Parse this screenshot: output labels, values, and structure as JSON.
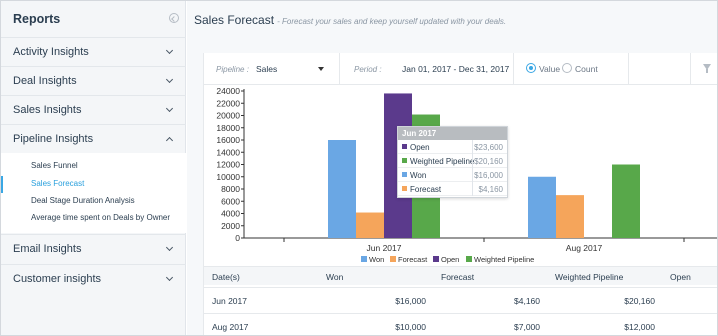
{
  "sidebar": {
    "title": "Reports",
    "sections": [
      {
        "label": "Activity Insights",
        "expanded": false
      },
      {
        "label": "Deal Insights",
        "expanded": false
      },
      {
        "label": "Sales Insights",
        "expanded": false
      },
      {
        "label": "Pipeline Insights",
        "expanded": true
      },
      {
        "label": "Email Insights",
        "expanded": false
      },
      {
        "label": "Customer insights",
        "expanded": false
      }
    ],
    "pipeline_items": [
      {
        "label": "Sales Funnel",
        "active": false
      },
      {
        "label": "Sales Forecast",
        "active": true
      },
      {
        "label": "Deal Stage Duration Analysis",
        "active": false
      },
      {
        "label": "Average time spent on Deals by Owner",
        "active": false
      }
    ]
  },
  "header": {
    "title": "Sales Forecast",
    "subtitle": "- Forecast your sales and keep yourself updated with your deals."
  },
  "filters": {
    "pipeline_label": "Pipeline :",
    "pipeline_value": "Sales",
    "period_label": "Period :",
    "period_value": "Jan 01, 2017 - Dec 31, 2017",
    "radio_value": "Value",
    "radio_count": "Count",
    "selected_mode": "Value",
    "filter_icon": "filter-icon"
  },
  "colors": {
    "won": "#6aa7e4",
    "forecast": "#f5a55b",
    "open": "#5b3a8c",
    "weighted": "#58a84a",
    "accent": "#3aa7e4"
  },
  "chart_data": {
    "type": "bar",
    "categories": [
      "Jun 2017",
      "Aug 2017"
    ],
    "series": [
      {
        "name": "Won",
        "values": [
          16000,
          10000
        ]
      },
      {
        "name": "Forecast",
        "values": [
          4160,
          7000
        ]
      },
      {
        "name": "Open",
        "values": [
          23600,
          null
        ]
      },
      {
        "name": "Weighted Pipeline",
        "values": [
          20160,
          12000
        ]
      }
    ],
    "y_ticks": [
      "0",
      "2000",
      "4000",
      "6000",
      "8000",
      "10000",
      "12000",
      "14000",
      "16000",
      "18000",
      "20000",
      "22000",
      "24000"
    ],
    "ylim": [
      0,
      24000
    ],
    "legend_position": "bottom",
    "tooltip": {
      "title": "Jun 2017",
      "rows": [
        {
          "name": "Open",
          "value": "$23,600",
          "color": "#5b3a8c"
        },
        {
          "name": "Weighted Pipeline",
          "value": "$20,160",
          "color": "#58a84a"
        },
        {
          "name": "Won",
          "value": "$16,000",
          "color": "#6aa7e4"
        },
        {
          "name": "Forecast",
          "value": "$4,160",
          "color": "#f5a55b"
        }
      ]
    }
  },
  "table": {
    "headers": [
      "Date(s)",
      "Won",
      "Forecast",
      "Weighted Pipeline",
      "Open"
    ],
    "rows": [
      {
        "date": "Jun 2017",
        "won": "$16,000",
        "forecast": "$4,160",
        "weighted": "$20,160",
        "open": ""
      },
      {
        "date": "Aug 2017",
        "won": "$10,000",
        "forecast": "$7,000",
        "weighted": "$12,000",
        "open": ""
      }
    ]
  }
}
